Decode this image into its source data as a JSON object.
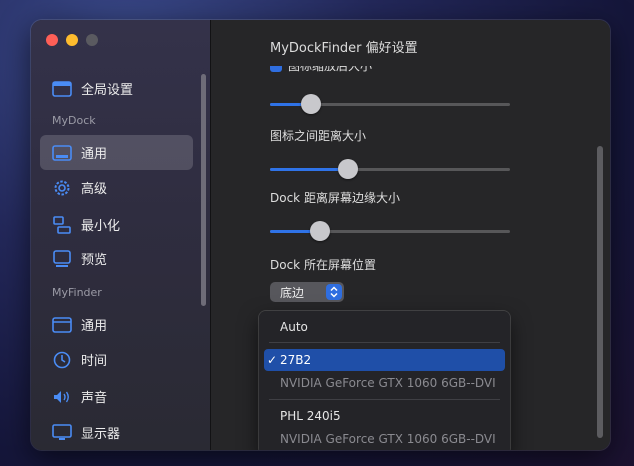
{
  "window": {
    "title": "MyDockFinder 偏好设置"
  },
  "sidebar": {
    "items": [
      {
        "label": "全局设置",
        "icon": "display-icon"
      },
      {
        "label": "通用",
        "icon": "dock-icon",
        "selected": true
      },
      {
        "label": "高级",
        "icon": "gear-icon"
      },
      {
        "label": "最小化",
        "icon": "minimize-icon"
      },
      {
        "label": "预览",
        "icon": "preview-icon"
      },
      {
        "label": "通用",
        "icon": "window-icon"
      },
      {
        "label": "时间",
        "icon": "clock-icon"
      },
      {
        "label": "声音",
        "icon": "speaker-icon"
      },
      {
        "label": "显示器",
        "icon": "monitor-icon"
      }
    ],
    "sections": [
      "MyDock",
      "MyFinder"
    ]
  },
  "main": {
    "clipped_label": "图标缩放后大小",
    "icon_spacing_label": "图标之间距离大小",
    "edge_distance_label": "Dock 距离屏幕边缘大小",
    "position_label": "Dock 所在屏幕位置",
    "position_value": "底边",
    "sliders": {
      "icon_zoom_size": 0.14,
      "icon_spacing": 0.31,
      "edge_distance": 0.18
    }
  },
  "menu": {
    "auto": "Auto",
    "display1_name": "27B2",
    "display1_gpu": "NVIDIA GeForce GTX 1060 6GB--DVI",
    "display2_name": "PHL 240i5",
    "display2_gpu": "NVIDIA GeForce GTX 1060 6GB--DVI",
    "check_glyph": "✓"
  },
  "colors": {
    "accent": "#2f73e8",
    "menu_selected": "#1f4fa8"
  }
}
